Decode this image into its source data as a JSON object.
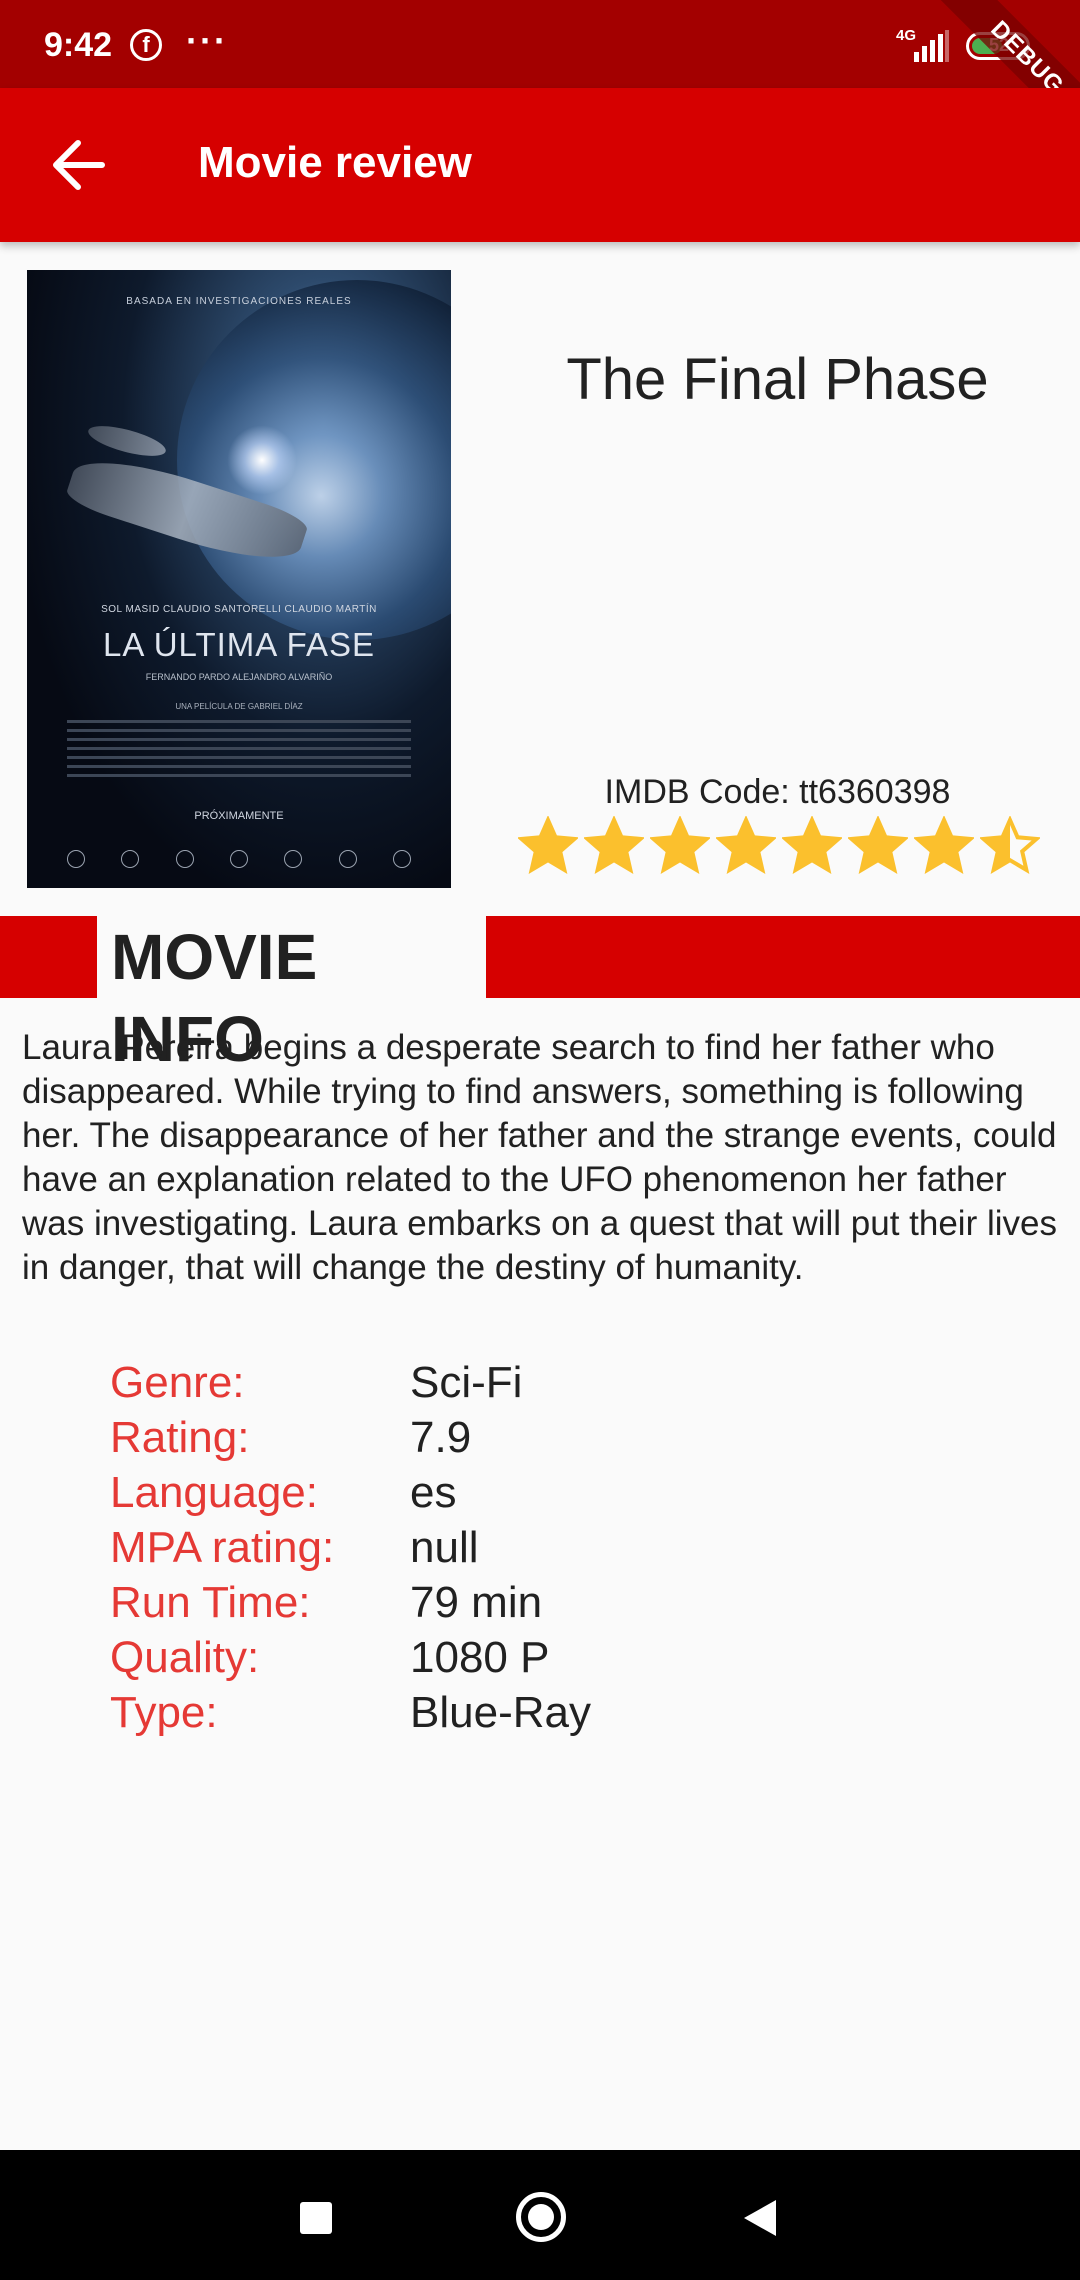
{
  "status_bar": {
    "time": "9:42",
    "network": "4G",
    "battery": "52",
    "debug_banner": "DEBUG",
    "notification_icons": [
      "facebook-icon",
      "more-dots-icon"
    ]
  },
  "app_bar": {
    "title": "Movie review",
    "back_icon": "arrow-back-icon"
  },
  "poster": {
    "tagline": "BASADA EN INVESTIGACIONES REALES",
    "cast": "SOL MASID    CLAUDIO SANTORELLI    CLAUDIO MARTÍN",
    "title": "LA ÚLTIMA FASE",
    "cast2": "FERNANDO PARDO    ALEJANDRO ALVARIÑO",
    "director": "UNA PELÍCULA DE GABRIEL DÍAZ",
    "soon": "PRÓXIMAMENTE"
  },
  "movie": {
    "title": "The Final Phase",
    "imdb_code": "IMDB Code: tt6360398",
    "rating_stars": 7.9,
    "stars_total": 8,
    "star_color": "#fbc02d"
  },
  "section": {
    "label": "MOVIE INFO"
  },
  "description": "Laura Pereira begins a desperate search to find her father who disappeared. While trying to find answers, something is following her. The disappearance of her father and the strange events, could have an explanation related to the UFO phenomenon her father was investigating. Laura embarks on a quest that will put their lives in danger, that will change the destiny of humanity.",
  "info": [
    {
      "key": "Genre:",
      "value": "Sci-Fi"
    },
    {
      "key": "Rating:",
      "value": "7.9"
    },
    {
      "key": "Language:",
      "value": "es"
    },
    {
      "key": "MPA rating:",
      "value": "null"
    },
    {
      "key": "Run Time:",
      "value": "79 min"
    },
    {
      "key": "Quality:",
      "value": "1080 P"
    },
    {
      "key": "Type:",
      "value": "Blue-Ray"
    }
  ],
  "colors": {
    "app_bar": "#d60000",
    "status_bar": "#a30000",
    "info_key": "#e53935"
  },
  "nav_bar": {
    "icons": [
      "recent-apps-icon",
      "home-icon",
      "back-icon"
    ]
  }
}
